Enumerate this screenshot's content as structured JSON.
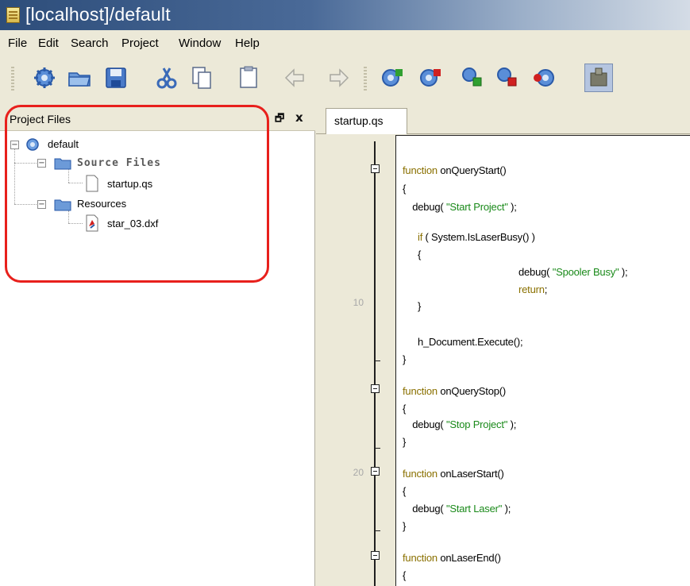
{
  "window": {
    "title": "[localhost]/default"
  },
  "menu": [
    "File",
    "Edit",
    "Search",
    "Project",
    "Window",
    "Help"
  ],
  "toolbar": {
    "buttons": [
      "new-project-icon",
      "open-folder-icon",
      "save-icon",
      "cut-icon",
      "copy-icon",
      "paste-icon",
      "undo-icon",
      "redo-icon",
      "run-icon",
      "stop-icon",
      "laser-start-icon",
      "laser-stop-icon",
      "debug-icon",
      "laser-device-icon"
    ]
  },
  "project_panel": {
    "title": "Project Files",
    "float_glyph": "🗗",
    "close_glyph": "x",
    "tree": {
      "root": "default",
      "source_folder": "Source Files",
      "source_file": "startup.qs",
      "resources_folder": "Resources",
      "resource_file": "star_03.dxf"
    }
  },
  "editor": {
    "tab": "startup.qs",
    "line_numbers": [
      "10",
      "20"
    ],
    "code": {
      "l1_kw": "function",
      "l1_rest": " onQueryStart()",
      "l2": "{",
      "l3_pre": "   debug( ",
      "l3_str": "\"Start Project\"",
      "l3_post": " );",
      "l4_kw": "if",
      "l4_rest": " ( System.IsLaserBusy() )",
      "l5": "{",
      "l6_pre": "debug( ",
      "l6_str": "\"Spooler Busy\"",
      "l6_post": " );",
      "l7_kw": "return",
      "l7_post": ";",
      "l8": "}",
      "l9": "h_Document.Execute();",
      "l10": "}",
      "l11_kw": "function",
      "l11_rest": " onQueryStop()",
      "l12": "{",
      "l13_pre": "   debug( ",
      "l13_str": "\"Stop Project\"",
      "l13_post": " );",
      "l14": "}",
      "l15_kw": "function",
      "l15_rest": " onLaserStart()",
      "l16": "{",
      "l17_pre": "   debug( ",
      "l17_str": "\"Start Laser\"",
      "l17_post": " );",
      "l18": "}",
      "l19_kw": "function",
      "l19_rest": " onLaserEnd()",
      "l20": "{"
    }
  },
  "colors": {
    "keyword": "#8a7000",
    "string": "#1a8a1a",
    "highlight_ring": "#e8201c"
  }
}
